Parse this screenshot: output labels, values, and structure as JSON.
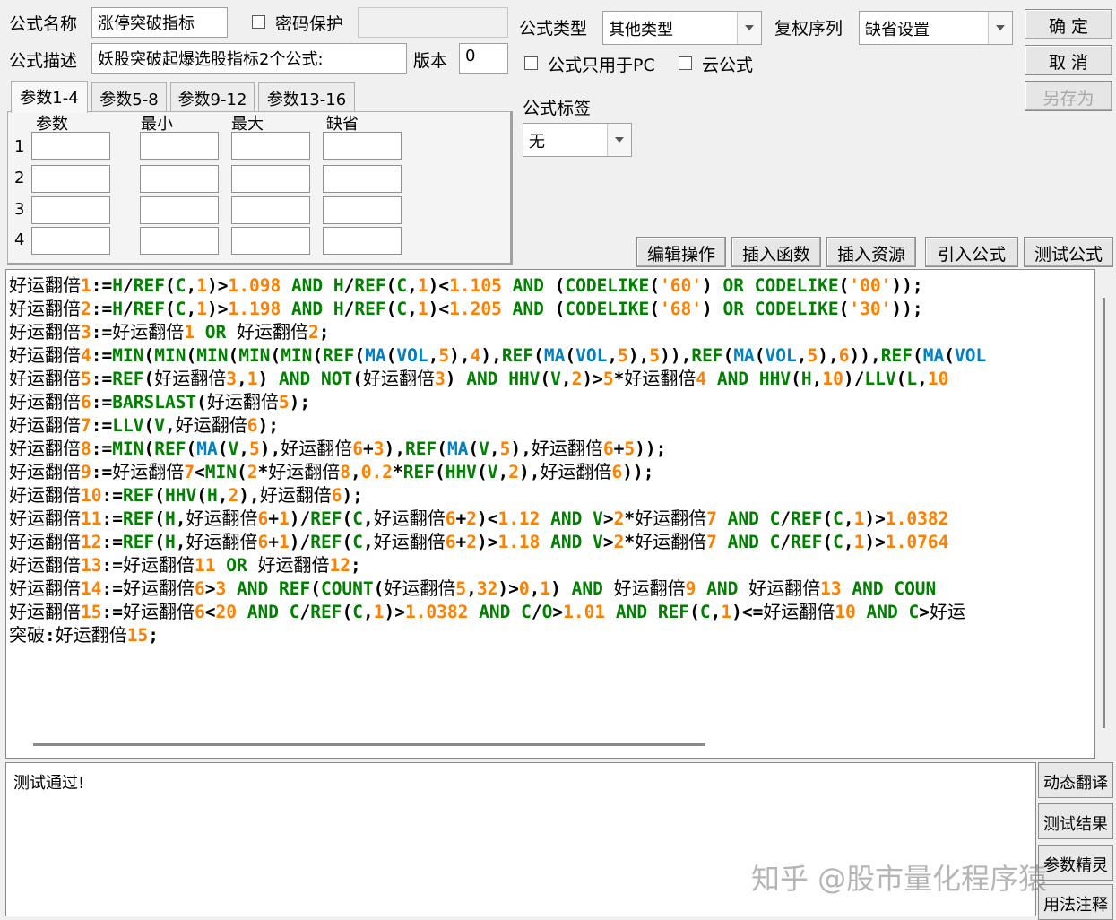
{
  "header": {
    "name_label": "公式名称",
    "name_value": "涨停突破指标",
    "password_label": "密码保护",
    "desc_label": "公式描述",
    "desc_value": "妖股突破起爆选股指标2个公式:",
    "version_label": "版本",
    "version_value": "0",
    "type_label": "公式类型",
    "type_value": "其他类型",
    "rights_label": "复权序列",
    "rights_value": "缺省设置",
    "pc_only_label": "公式只用于PC",
    "cloud_label": "云公式",
    "tag_label": "公式标签",
    "tag_value": "无"
  },
  "buttons": {
    "ok": "确 定",
    "cancel": "取 消",
    "save_as": "另存为",
    "edit_ops": "编辑操作",
    "insert_func": "插入函数",
    "insert_res": "插入资源",
    "import_formula": "引入公式",
    "test_formula": "测试公式"
  },
  "params": {
    "tabs": [
      "参数1-4",
      "参数5-8",
      "参数9-12",
      "参数13-16"
    ],
    "columns": [
      "参数",
      "最小",
      "最大",
      "缺省"
    ],
    "rows": [
      "1",
      "2",
      "3",
      "4"
    ]
  },
  "code_lines": [
    "好运翻倍1:=H/REF(C,1)>1.098 AND H/REF(C,1)<1.105 AND (CODELIKE('60') OR CODELIKE('00'));",
    "好运翻倍2:=H/REF(C,1)>1.198 AND H/REF(C,1)<1.205 AND (CODELIKE('68') OR CODELIKE('30'));",
    "好运翻倍3:=好运翻倍1 OR 好运翻倍2;",
    "好运翻倍4:=MIN(MIN(MIN(MIN(MIN(REF(MA(VOL,5),4),REF(MA(VOL,5),5)),REF(MA(VOL,5),6)),REF(MA(VOL",
    "好运翻倍5:=REF(好运翻倍3,1) AND NOT(好运翻倍3) AND HHV(V,2)>5*好运翻倍4 AND HHV(H,10)/LLV(L,10",
    "好运翻倍6:=BARSLAST(好运翻倍5);",
    "好运翻倍7:=LLV(V,好运翻倍6);",
    "好运翻倍8:=MIN(REF(MA(V,5),好运翻倍6+3),REF(MA(V,5),好运翻倍6+5));",
    "好运翻倍9:=好运翻倍7<MIN(2*好运翻倍8,0.2*REF(HHV(V,2),好运翻倍6));",
    "好运翻倍10:=REF(HHV(H,2),好运翻倍6);",
    "好运翻倍11:=REF(H,好运翻倍6+1)/REF(C,好运翻倍6+2)<1.12 AND V>2*好运翻倍7 AND C/REF(C,1)>1.0382",
    "好运翻倍12:=REF(H,好运翻倍6+1)/REF(C,好运翻倍6+2)>1.18 AND V>2*好运翻倍7 AND C/REF(C,1)>1.0764",
    "好运翻倍13:=好运翻倍11 OR 好运翻倍12;",
    "好运翻倍14:=好运翻倍6>3 AND REF(COUNT(好运翻倍5,32)>0,1) AND 好运翻倍9 AND 好运翻倍13 AND COUN",
    "好运翻倍15:=好运翻倍6<20 AND C/REF(C,1)>1.0382 AND C/O>1.01 AND REF(C,1)<=好运翻倍10 AND C>好运",
    "突破:好运翻倍15;"
  ],
  "output_text": "测试通过!",
  "side_buttons": [
    "动态翻译",
    "测试结果",
    "参数精灵",
    "用法注释"
  ],
  "watermark": "知乎 @股市量化程序猿",
  "colors": {
    "keyword": "#008000",
    "function": "#0080c0",
    "number": "#ff8000",
    "default": "#000080"
  }
}
